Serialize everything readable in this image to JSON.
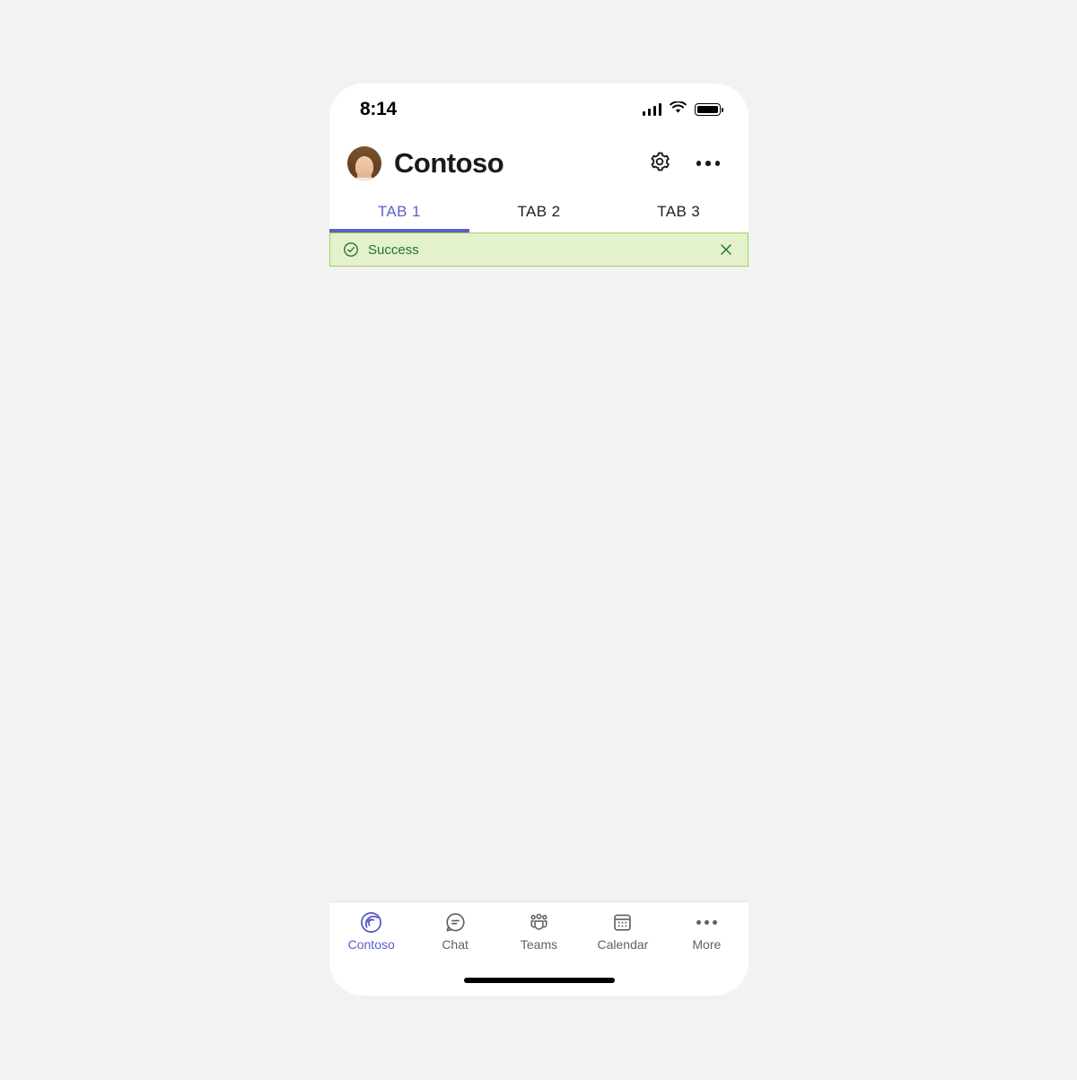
{
  "status_bar": {
    "time": "8:14",
    "signal_icon": "signal-bars-icon",
    "wifi_icon": "wifi-icon",
    "battery_icon": "battery-full-icon"
  },
  "header": {
    "title": "Contoso",
    "avatar_icon": "avatar",
    "settings_icon": "gear-icon",
    "more_icon": "more-horizontal-icon"
  },
  "tabs": {
    "items": [
      {
        "label": "TAB 1",
        "active": true
      },
      {
        "label": "TAB 2",
        "active": false
      },
      {
        "label": "TAB 3",
        "active": false
      }
    ],
    "active_color": "#5b5fc7"
  },
  "notification": {
    "message": "Success",
    "status": "success",
    "icon": "check-circle-icon",
    "close_icon": "close-icon",
    "background_color": "#e3f2ca",
    "border_color": "#a4cf63",
    "text_color": "#23713e"
  },
  "bottom_nav": {
    "items": [
      {
        "label": "Contoso",
        "icon": "contoso-logo-icon",
        "active": true
      },
      {
        "label": "Chat",
        "icon": "chat-bubble-icon",
        "active": false
      },
      {
        "label": "Teams",
        "icon": "teams-people-icon",
        "active": false
      },
      {
        "label": "Calendar",
        "icon": "calendar-icon",
        "active": false
      },
      {
        "label": "More",
        "icon": "more-horizontal-icon",
        "active": false
      }
    ],
    "active_color": "#5b5fc7",
    "inactive_color": "#616161"
  },
  "colors": {
    "page_background": "#f2f2f2",
    "phone_background": "#ffffff",
    "content_background": "#f2f2f2",
    "accent": "#5b5fc7"
  }
}
